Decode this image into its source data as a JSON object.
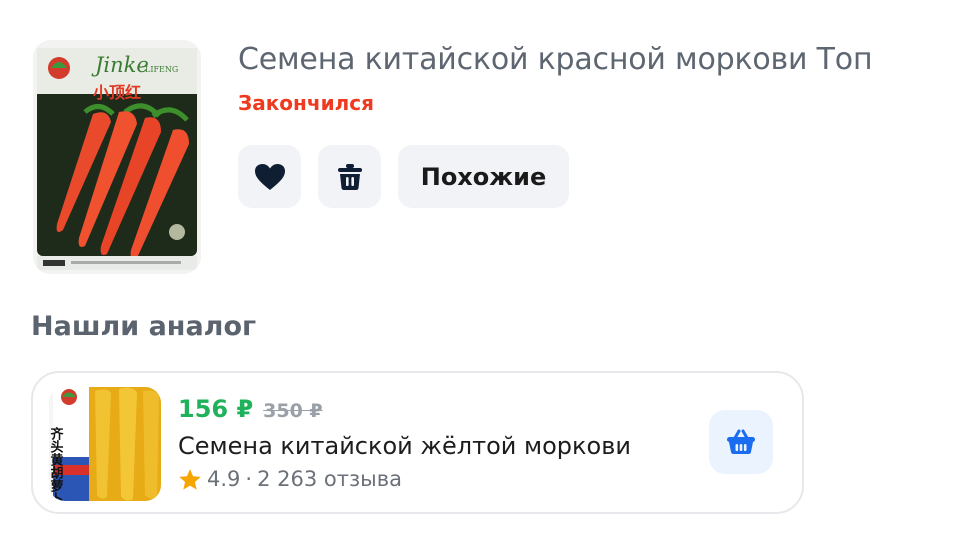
{
  "product": {
    "title": "Семена китайской красной моркови Топ",
    "status": "Закончился",
    "image_alt": "carrot-seed-pack",
    "pack_brand": "Jinke",
    "pack_brand_sub": "LIFENG",
    "pack_chinese": "小顶红"
  },
  "actions": {
    "favorite_icon": "heart-icon",
    "delete_icon": "trash-icon",
    "similar_label": "Похожие"
  },
  "analog_section": {
    "title": "Нашли аналог",
    "item": {
      "price_new": "156 ₽",
      "price_old": "350 ₽",
      "title": "Семена китайской жёлтой моркови",
      "rating": "4.9",
      "separator": "·",
      "reviews": "2 263 отзыва",
      "pack_chinese": "齐头黄胡萝卜",
      "cart_icon": "basket-icon"
    }
  },
  "colors": {
    "status": "#ef3a1f",
    "price_new": "#1fb25a",
    "button_bg": "#f1f3f6",
    "cart_bg": "#eaf3fe",
    "cart_icon": "#1a6cf0",
    "star": "#f7a600"
  }
}
